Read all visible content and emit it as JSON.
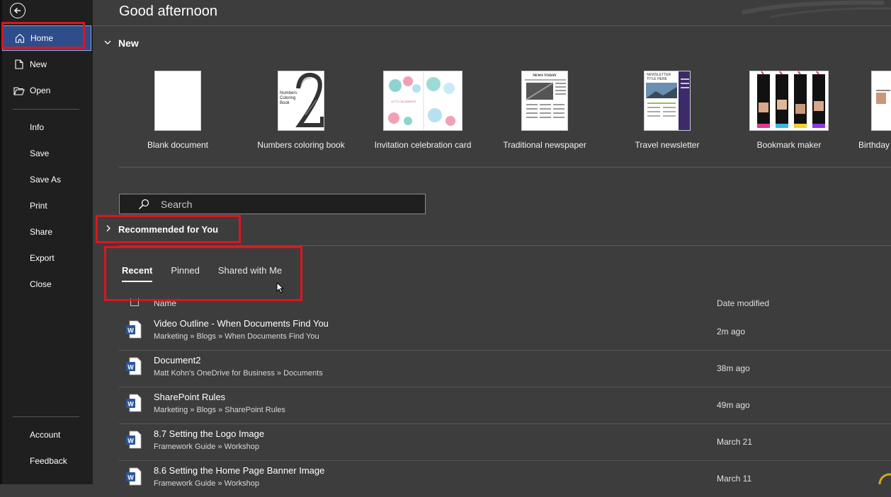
{
  "sidebar": {
    "back_label": "Back",
    "items_top": [
      {
        "label": "Home",
        "icon": "home-icon"
      },
      {
        "label": "New",
        "icon": "new-document-icon"
      },
      {
        "label": "Open",
        "icon": "folder-open-icon"
      }
    ],
    "items_mid": [
      "Info",
      "Save",
      "Save As",
      "Print",
      "Share",
      "Export",
      "Close"
    ],
    "items_bottom": [
      "Account",
      "Feedback"
    ]
  },
  "main": {
    "greeting": "Good afternoon",
    "new_section": "New",
    "templates": [
      {
        "name": "Blank document"
      },
      {
        "name": "Numbers coloring book",
        "thumb_text": "Numbers Coloring Book"
      },
      {
        "name": "Invitation celebration card",
        "thumb_text": "LET'S CELEBRATE"
      },
      {
        "name": "Traditional newspaper",
        "thumb_text": "NEWS TODAY"
      },
      {
        "name": "Travel newsletter",
        "thumb_text": "NEWSLETTER TITLE HERE"
      },
      {
        "name": "Bookmark maker"
      },
      {
        "name": "Birthday"
      }
    ],
    "search_placeholder": "Search",
    "recommended": "Recommended for You",
    "tabs": [
      "Recent",
      "Pinned",
      "Shared with Me"
    ],
    "columns": {
      "name": "Name",
      "date": "Date modified"
    },
    "files": [
      {
        "title": "Video Outline - When Documents Find You",
        "path": "Marketing » Blogs » When Documents Find You",
        "date": "2m ago"
      },
      {
        "title": "Document2",
        "path": "Matt Kohn's OneDrive for Business » Documents",
        "date": "38m ago"
      },
      {
        "title": "SharePoint Rules",
        "path": "Marketing » Blogs » SharePoint Rules",
        "date": "49m ago"
      },
      {
        "title": "8.7 Setting the Logo Image",
        "path": "Framework Guide » Workshop",
        "date": "March 21"
      },
      {
        "title": "8.6 Setting the Home Page Banner Image",
        "path": "Framework Guide » Workshop",
        "date": "March 11"
      }
    ]
  },
  "colors": {
    "sidebar_bg": "#1f1f1f",
    "main_bg": "#3d3d3d",
    "active_item": "#2e4d8a",
    "highlight_box": "#e0141d",
    "word_blue": "#2b579a"
  }
}
